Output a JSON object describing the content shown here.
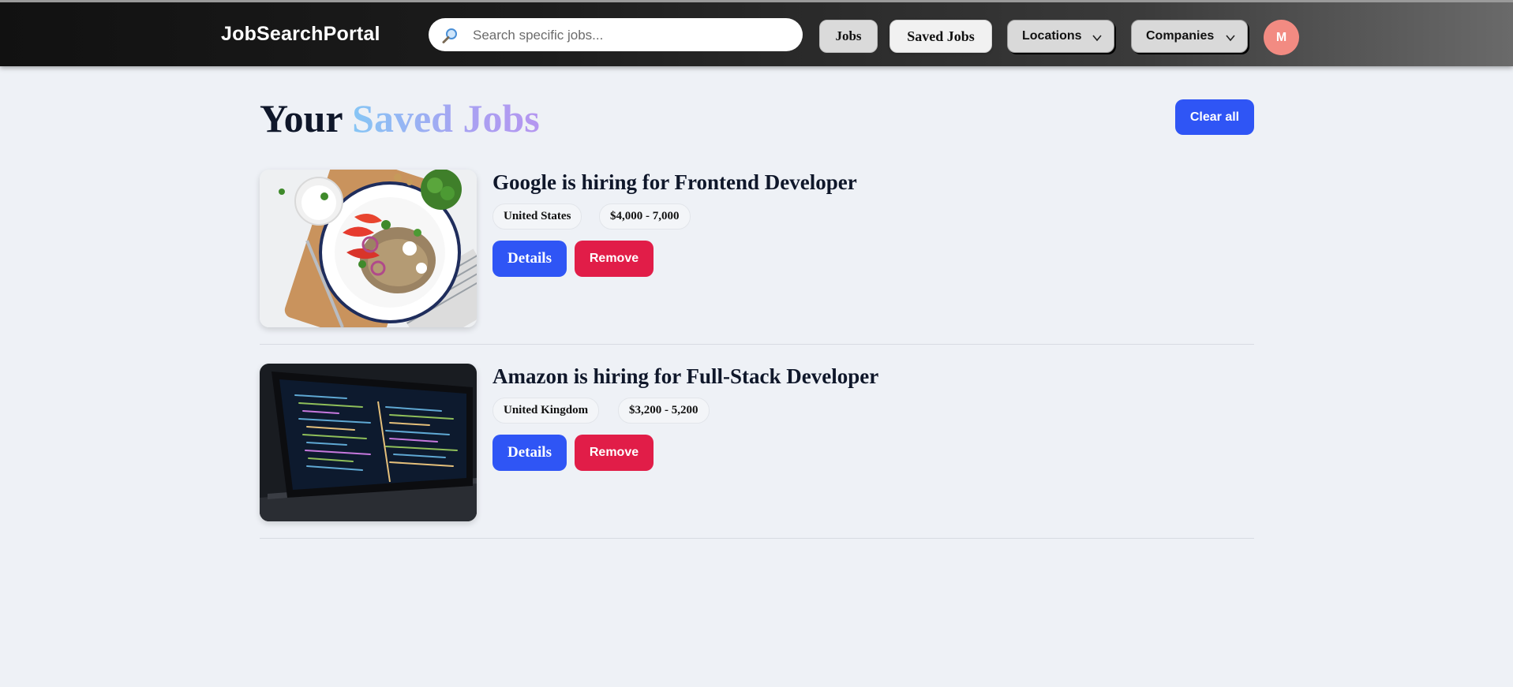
{
  "navbar": {
    "logo": "JobSearchPortal",
    "search_placeholder": "Search specific jobs...",
    "search_value": "",
    "jobs_label": "Jobs",
    "saved_jobs_label": "Saved Jobs",
    "locations_label": "Locations",
    "companies_label": "Companies",
    "avatar_initial": "M"
  },
  "page": {
    "title_prefix": "Your",
    "title_highlight": "Saved Jobs",
    "clear_all_label": "Clear all"
  },
  "jobs": [
    {
      "title": "Google is hiring for Frontend Developer",
      "location": "United States",
      "salary": "$4,000 - 7,000",
      "image": "food-plate-photo",
      "details_label": "Details",
      "remove_label": "Remove"
    },
    {
      "title": "Amazon is hiring for Full-Stack Developer",
      "location": "United Kingdom",
      "salary": "$3,200 - 5,200",
      "image": "laptop-code-photo",
      "details_label": "Details",
      "remove_label": "Remove"
    }
  ],
  "colors": {
    "primary_blue": "#2f55f5",
    "remove_red": "#e11d48",
    "avatar": "#f28b82",
    "background": "#eef1f6"
  },
  "icons": {
    "search": "search-icon",
    "dropdown": "chevron-down-icon"
  }
}
